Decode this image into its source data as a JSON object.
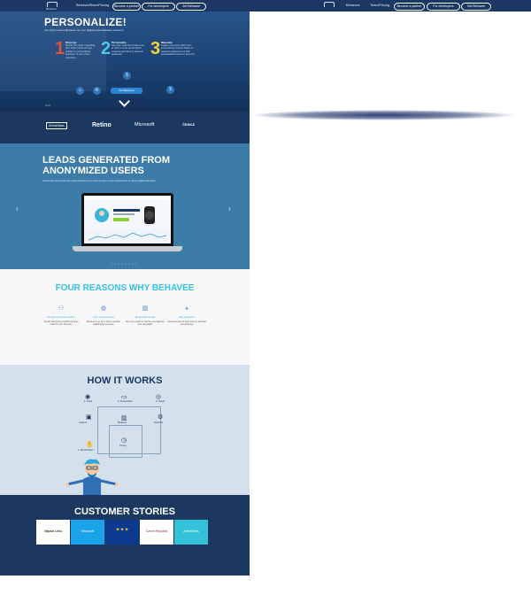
{
  "nav": {
    "logo_text": "Behavee",
    "links": [
      "Behavee",
      "Team",
      "Pricing"
    ],
    "buttons": [
      "Become a partner",
      "For developers",
      "Get Behavee"
    ]
  },
  "hero": {
    "title": "PERSONALIZE!",
    "subtitle": "Use Open source Behavee for your digital personalization solutions",
    "steps": [
      {
        "num": "1",
        "title": "Discover",
        "text": "Identify the visitors regarding their online habits and get answers to personalized questions of your online marketing",
        "color": "#e0533b"
      },
      {
        "num": "2",
        "title": "Personalize",
        "text": "Use open code and create a set of rules to show personalized contents and offers to selected audiences",
        "color": "#4fc3e8"
      },
      {
        "num": "3",
        "title": "Monetize",
        "text": "Create revenue by offers from personalized contents based on selected audiences and their personalized content or web visit",
        "color": "#f2d43a"
      }
    ],
    "cta": "Get Behavee",
    "social": "f  t  in",
    "icons": [
      "person-icon",
      "dollar-icon",
      "gear-icon",
      "dollar-icon"
    ]
  },
  "logos": {
    "items": [
      "ArenaStars",
      "Retino",
      "Microsoft",
      "ČESKÁ"
    ]
  },
  "leads": {
    "title": "LEADS GENERATED FROM ANONYMIZED USERS",
    "subtitle": "Generate new business opportunities from anonymous users and based on their digital behavior",
    "prev": "‹",
    "next": "›",
    "dots": "• • • • • • • •"
  },
  "reasons": {
    "title": "FOUR REASONS WHY BEHAVEE",
    "items": [
      {
        "icon": "users-icon",
        "title": "Identify anonymous visitors",
        "text": "Identify anonymous visitors and gain leads for your business"
      },
      {
        "icon": "globe-icon",
        "title": "Open source solution",
        "text": "Behavee is an open source solution available for everyone"
      },
      {
        "icon": "chart-icon",
        "title": "Measurable results",
        "text": "See your results in real time and optimize your campaigns"
      },
      {
        "icon": "share-icon",
        "title": "Easy integration",
        "text": "Just a few lines of code and you can start personalizing"
      }
    ]
  },
  "how": {
    "title": "HOW IT WORKS",
    "steps": [
      {
        "label": "1. Track",
        "icon": "eye-icon"
      },
      {
        "label": "2. Personalize",
        "icon": "screen-icon"
      },
      {
        "label": "3. Target",
        "icon": "target-icon"
      },
      {
        "label": "Analyze",
        "icon": "monitor-icon"
      },
      {
        "label": "Measure",
        "icon": "bar-chart-icon"
      },
      {
        "label": "Optimize",
        "icon": "gear-icon"
      },
      {
        "label": "4. Monetization",
        "icon": "hand-coin-icon"
      },
      {
        "label": "Timing",
        "icon": "clock-icon"
      }
    ]
  },
  "stories": {
    "title": "CUSTOMER STORIES",
    "cards": [
      {
        "label": "Nápad Léku",
        "bg": "#ffffff",
        "fg": "#2b4a1e"
      },
      {
        "label": "Microsoft",
        "bg": "#1aa3e8",
        "fg": "#ffffff"
      },
      {
        "label": "EU",
        "bg": "#0c3a8e",
        "fg": "#f2d43a"
      },
      {
        "label": "Czech Republic",
        "bg": "#ffffff",
        "fg": "#7a1f2b"
      },
      {
        "label": "ArenaStars",
        "bg": "#33c2d7",
        "fg": "#ffffff"
      }
    ]
  }
}
